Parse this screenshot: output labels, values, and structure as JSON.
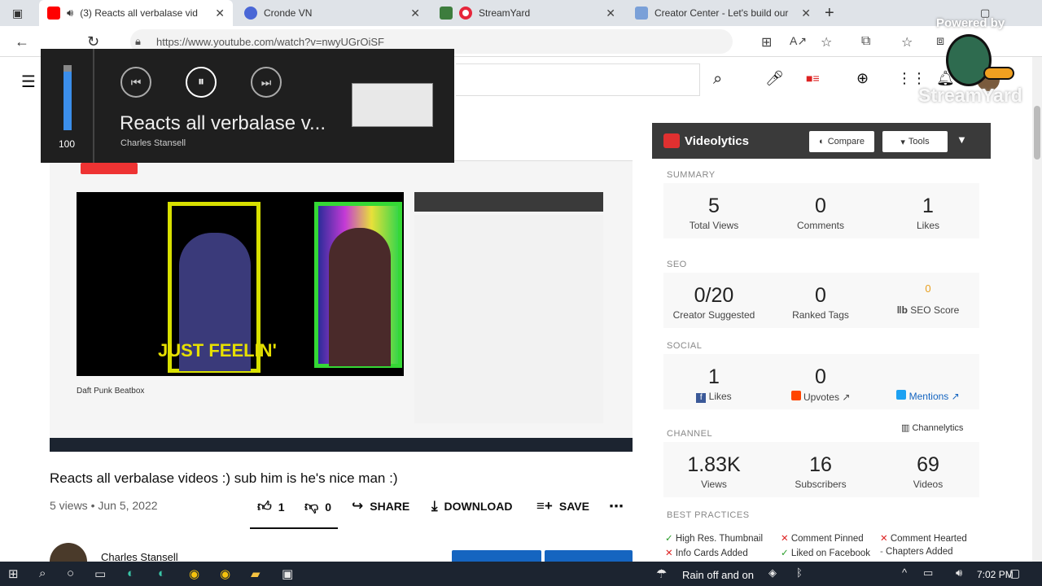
{
  "tabs": [
    {
      "label": "(3) Reacts all verbalase vid",
      "color": "#ff0000",
      "active": true
    },
    {
      "label": "Cronde VN",
      "color": "#4a67d6"
    },
    {
      "label": "StreamYard",
      "color": "#e6263b"
    },
    {
      "label": "Creator Center - Let's build our",
      "color": "#7aa0d8"
    }
  ],
  "address": {
    "url": "https://www.youtube.com/watch?v=nwyUGrOiSF"
  },
  "media_overlay": {
    "volume": "100",
    "title": "Reacts all verbalase v...",
    "artist": "Charles Stansell"
  },
  "inner_video": {
    "text": "JUST FEELIN'",
    "channel": "Daft Punk Beatbox"
  },
  "video": {
    "title": "Reacts all verbalase videos :) sub him is he's nice man :)",
    "meta": "5 views • Jun 5, 2022",
    "likes": "1",
    "dislikes": "0",
    "share": "SHARE",
    "download": "DOWNLOAD",
    "save": "SAVE",
    "channel": "Charles Stansell"
  },
  "panel": {
    "brand": "Videolytics",
    "compare": "Compare",
    "tools": "Tools",
    "summary_label": "SUMMARY",
    "summary": [
      {
        "n": "5",
        "l": "Total Views"
      },
      {
        "n": "0",
        "l": "Comments"
      },
      {
        "n": "1",
        "l": "Likes"
      }
    ],
    "seo_label": "SEO",
    "seo": [
      {
        "n": "0/20",
        "l": "Creator Suggested"
      },
      {
        "n": "0",
        "l": "Ranked Tags"
      },
      {
        "n": "0",
        "l": "SEO Score"
      }
    ],
    "social_label": "SOCIAL",
    "social": [
      {
        "n": "1",
        "l": "Likes"
      },
      {
        "n": "0",
        "l": "Upvotes"
      },
      {
        "n": "",
        "l": "Mentions"
      }
    ],
    "channel_label": "CHANNEL",
    "channelytics": "Channelytics",
    "channel": [
      {
        "n": "1.83K",
        "l": "Views"
      },
      {
        "n": "16",
        "l": "Subscribers"
      },
      {
        "n": "69",
        "l": "Videos"
      }
    ],
    "bp_label": "BEST PRACTICES",
    "bp": [
      {
        "t": "High Res. Thumbnail",
        "ok": true
      },
      {
        "t": "Comment Pinned",
        "ok": false
      },
      {
        "t": "Comment Hearted",
        "ok": false
      },
      {
        "t": "Info Cards Added",
        "ok": false
      },
      {
        "t": "Liked on Facebook",
        "ok": true
      },
      {
        "t": "Chapters Added",
        "ok": false
      }
    ]
  },
  "streamyard": {
    "powered": "Powered by",
    "brand": "StreamYard"
  },
  "taskbar": {
    "weather": "Rain off and on",
    "time": "7:02 PM"
  }
}
